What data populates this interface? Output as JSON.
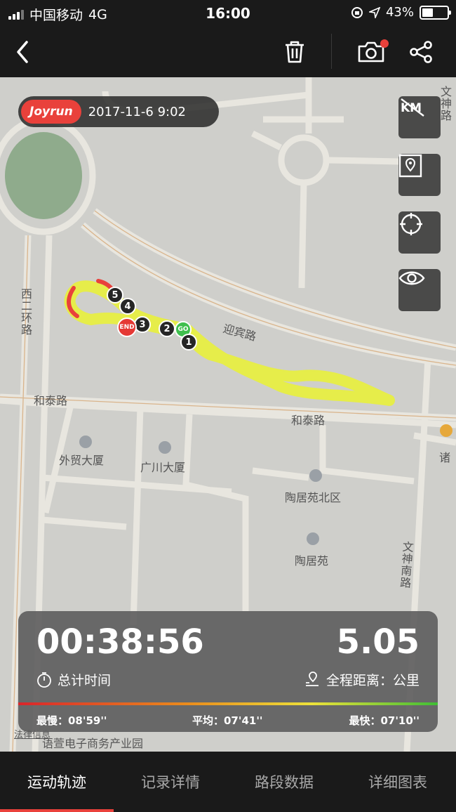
{
  "status_bar": {
    "carrier": "中国移动",
    "network": "4G",
    "time": "16:00",
    "battery": "43%"
  },
  "nav": {
    "back_icon": "chevron-left-icon",
    "delete_icon": "trash-icon",
    "camera_icon": "camera-icon",
    "share_icon": "share-icon"
  },
  "badge": {
    "brand": "Joyrun",
    "date": "2017-11-6 9:02"
  },
  "map_labels": {
    "road_west2": "西二环路",
    "road_yingbin": "迎宾路",
    "road_hetai1": "和泰路",
    "road_hetai2": "和泰路",
    "poi_waimao": "外贸大厦",
    "poi_guangchuan": "广川大厦",
    "poi_taojuyuan_north": "陶居苑北区",
    "poi_taojuyuan": "陶居苑",
    "road_wenshen": "文神南路",
    "road_wen": "文神路",
    "road_zhu": "诸",
    "legal": "法律信息",
    "park": "语萱电子商务产业园"
  },
  "route_markers": {
    "go": "GO",
    "end": "END",
    "km1": "1",
    "km2": "2",
    "km3": "3",
    "km4": "4",
    "km5": "5"
  },
  "stats": {
    "duration": "00:38:56",
    "duration_label": "总计时间",
    "distance": "5.05",
    "distance_label": "全程距离：公里",
    "slowest": "最慢：08'59''",
    "average": "平均：07'41''",
    "fastest": "最快：07'10''"
  },
  "tabs": [
    {
      "label": "运动轨迹",
      "active": true
    },
    {
      "label": "记录详情",
      "active": false
    },
    {
      "label": "路段数据",
      "active": false
    },
    {
      "label": "详细图表",
      "active": false
    }
  ],
  "colors": {
    "accent": "#e9413b",
    "route": "#e8f03c",
    "go": "#3fbf4e"
  }
}
